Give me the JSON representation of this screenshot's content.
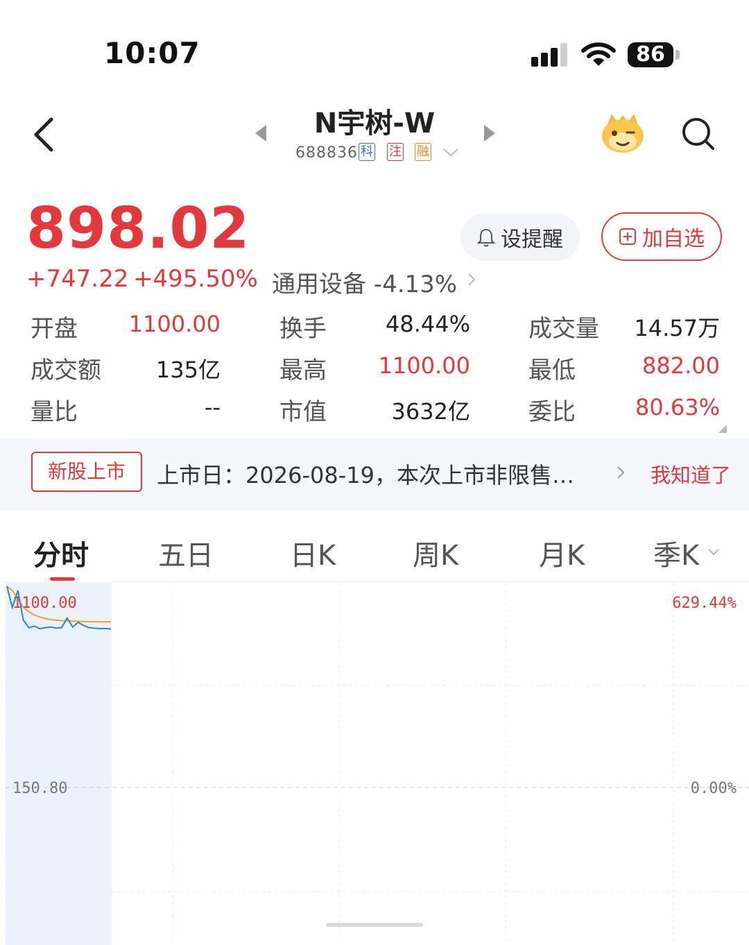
{
  "status_bar": {
    "time": "10:07",
    "battery": "86"
  },
  "header": {
    "stock_name": "N宇树-W",
    "stock_code": "688836",
    "tags": [
      "科",
      "注",
      "融"
    ]
  },
  "quote": {
    "price": "898.02",
    "change": "+747.22",
    "change_pct": "+495.50%",
    "sector": "通用设备 -4.13%"
  },
  "actions": {
    "remind_label": "设提醒",
    "watchlist_label": "加自选"
  },
  "stats": [
    {
      "label": "开盘",
      "value": "1100.00",
      "red": true
    },
    {
      "label": "换手",
      "value": "48.44%",
      "red": false
    },
    {
      "label": "成交量",
      "value": "14.57万",
      "red": false
    },
    {
      "label": "成交额",
      "value": "135亿",
      "red": false
    },
    {
      "label": "最高",
      "value": "1100.00",
      "red": true
    },
    {
      "label": "最低",
      "value": "882.00",
      "red": true
    },
    {
      "label": "量比",
      "value": "--",
      "red": false
    },
    {
      "label": "市值",
      "value": "3632亿",
      "red": false
    },
    {
      "label": "委比",
      "value": "80.63%",
      "red": true
    }
  ],
  "notice": {
    "badge": "新股上市",
    "text": "上市日：2026-08-19，本次上市非限售…",
    "dismiss": "我知道了"
  },
  "tabs": [
    "分时",
    "五日",
    "日K",
    "周K",
    "月K",
    "季K"
  ],
  "chart": {
    "price_high": "1100.00",
    "price_base": "150.80",
    "pct_high": "629.44%",
    "pct_base": "0.00%",
    "price_series": [
      1100,
      1000,
      1080,
      940,
      905,
      912,
      900,
      905,
      908,
      903,
      905,
      950,
      908,
      930,
      915,
      905,
      902,
      900,
      901,
      898
    ],
    "avg_series": [
      1100,
      1080,
      1040,
      1000,
      980,
      965,
      955,
      948,
      943,
      940,
      938,
      937,
      936,
      935,
      934,
      933,
      933,
      932,
      932,
      932
    ]
  },
  "colors": {
    "up": "#e4393c",
    "price_line": "#2d83d6",
    "avg_line": "#f0a030"
  }
}
